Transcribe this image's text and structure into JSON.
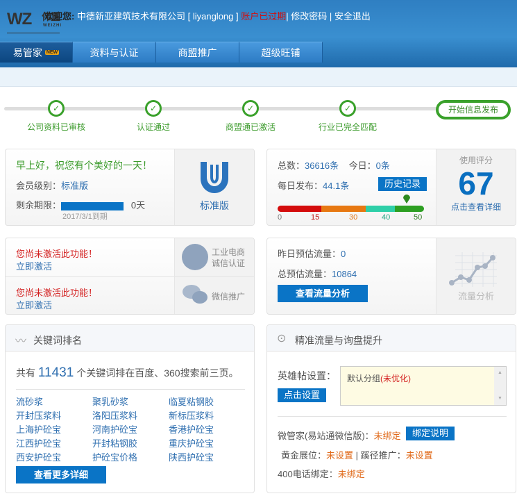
{
  "header": {
    "logo": "WZ",
    "logo_cn": "伟置",
    "logo_sub": "WEIZHI",
    "welcome": "欢迎您:",
    "company": "中德新亚建筑技术有限公司",
    "username": "[ liyanglong ]",
    "account_status": "账户已过期",
    "sep": "|",
    "change_password": "修改密码",
    "logout": "安全退出"
  },
  "nav": [
    {
      "label": "易管家",
      "badge": "NEW"
    },
    {
      "label": "资料与认证"
    },
    {
      "label": "商盟推广"
    },
    {
      "label": "超级旺铺"
    }
  ],
  "steps": [
    "公司资料已审核",
    "认证通过",
    "商盟通已激活",
    "行业已完全匹配"
  ],
  "publish_button": "开始信息发布",
  "member": {
    "greeting": "早上好，祝您有个美好的一天！",
    "level_label": "会员级别：",
    "level": "标准版",
    "remain_label": "剩余期限：",
    "remain_days": "0天",
    "remain_fraction": 1.0,
    "expire": "2017/3/1到期",
    "badge_label": "标准版"
  },
  "stats": {
    "total_label": "总数：",
    "total": "36616条",
    "today_label": "今日：",
    "today": "0条",
    "daily_label": "每日发布：",
    "daily": "44.1条",
    "history_button": "历史记录",
    "scale": [
      "0",
      "15",
      "30",
      "40",
      "50"
    ],
    "marker_value": 44.1,
    "score_label": "使用评分",
    "score": "67",
    "score_link": "点击查看详细"
  },
  "features": [
    {
      "warning": "您尚未激活此功能！",
      "activate": "立即激活",
      "name1": "工业电商",
      "name2": "诚信认证"
    },
    {
      "warning": "您尚未激活此功能！",
      "activate": "立即激活",
      "name1": "微信推广"
    }
  ],
  "traffic": {
    "yesterday_label": "昨日预估流量：",
    "yesterday": "0",
    "total_label": "总预估流量：",
    "total": "10864",
    "button": "查看流量分析",
    "side_label": "流量分析"
  },
  "keywords": {
    "title": "关键词排名",
    "prefix": "共有",
    "count": "11431",
    "suffix": "个关键词排在百度、360搜索前三页。",
    "items": [
      "流砂浆",
      "聚乳砂浆",
      "临夏粘钢胶",
      "开封压浆料",
      "洛阳压浆料",
      "新标压浆料",
      "上海护砼宝",
      "河南护砼宝",
      "香港护砼宝",
      "江西护砼宝",
      "开封粘钢胶",
      "重庆护砼宝",
      "西安护砼宝",
      "护砼宝价格",
      "陕西护砼宝"
    ],
    "more_button": "查看更多详细"
  },
  "precise": {
    "title": "精准流量与询盘提升",
    "hero_label": "英雄帖设置：",
    "set_button": "点击设置",
    "group": "默认分组",
    "group_status": "(未优化)",
    "wechat_label": "微管家(易站通微信版)：",
    "wechat_status": "未绑定",
    "bind_button": "绑定说明",
    "gold_label": "黄金展位：",
    "gold_status": "未设置",
    "sep": "|",
    "path_label": "蹊径推广：",
    "path_status": "未设置",
    "phone_label": "400电话绑定：",
    "phone_status": "未绑定"
  }
}
